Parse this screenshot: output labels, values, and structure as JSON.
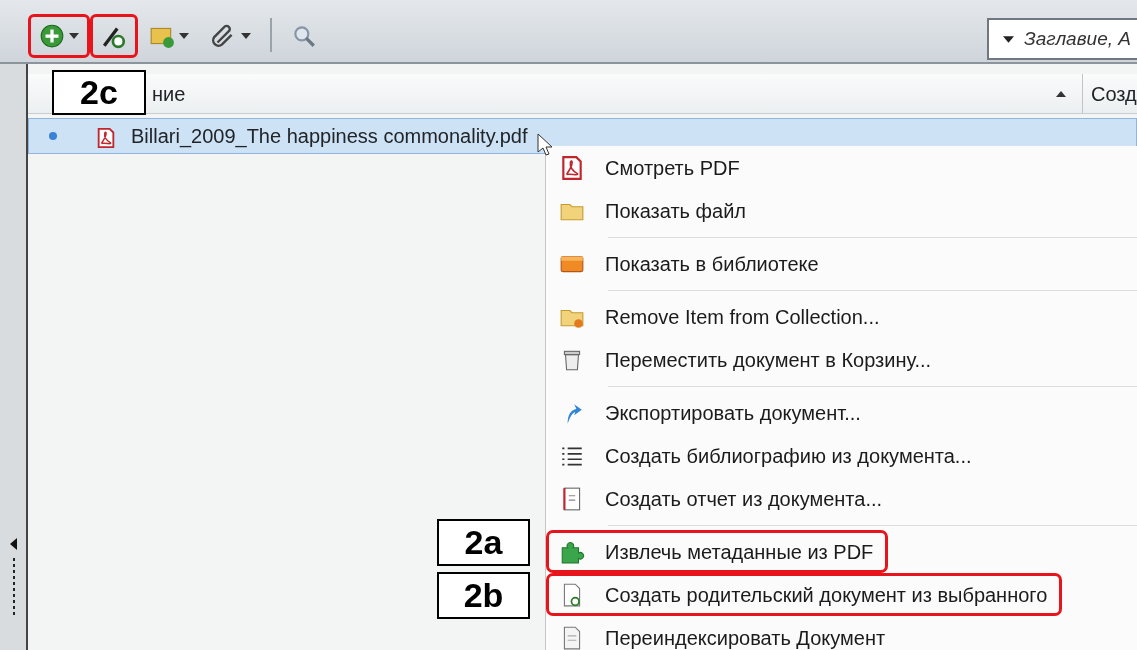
{
  "toolbar": {
    "buttons": [
      {
        "kind": "add",
        "dropdown": true,
        "highlighted": true
      },
      {
        "kind": "wand",
        "dropdown": false,
        "highlighted": true
      },
      {
        "kind": "folder-add",
        "dropdown": true,
        "highlighted": false
      },
      {
        "kind": "paperclip",
        "dropdown": true,
        "highlighted": false
      },
      {
        "kind": "search",
        "dropdown": false,
        "highlighted": false
      }
    ],
    "search": {
      "value": "Заглавие, А"
    }
  },
  "table": {
    "columns": [
      {
        "label": "ние"
      },
      {
        "label": "Созд"
      }
    ],
    "rows": [
      {
        "title": "Billari_2009_The happiness commonality.pdf",
        "selected": true,
        "unread": true
      }
    ]
  },
  "context_menu": {
    "groups": [
      [
        {
          "label": "Смотреть PDF",
          "highlighted": false
        },
        {
          "label": "Показать файл",
          "highlighted": false
        }
      ],
      [
        {
          "label": "Показать в библиотеке",
          "highlighted": false
        }
      ],
      [
        {
          "label": "Remove Item from Collection...",
          "highlighted": false
        },
        {
          "label": "Переместить документ в Корзину...",
          "highlighted": false
        }
      ],
      [
        {
          "label": "Экспортировать документ...",
          "highlighted": false
        },
        {
          "label": "Создать библиографию из документа...",
          "highlighted": false
        },
        {
          "label": "Создать отчет из документа...",
          "highlighted": false
        }
      ],
      [
        {
          "label": "Извлечь метаданные из PDF",
          "highlighted": true
        },
        {
          "label": "Создать родительский документ из выбранного",
          "highlighted": true
        },
        {
          "label": "Переиндексировать Документ",
          "highlighted": false
        }
      ]
    ]
  },
  "annotations": [
    {
      "label": "2c"
    },
    {
      "label": "2a"
    },
    {
      "label": "2b"
    }
  ]
}
